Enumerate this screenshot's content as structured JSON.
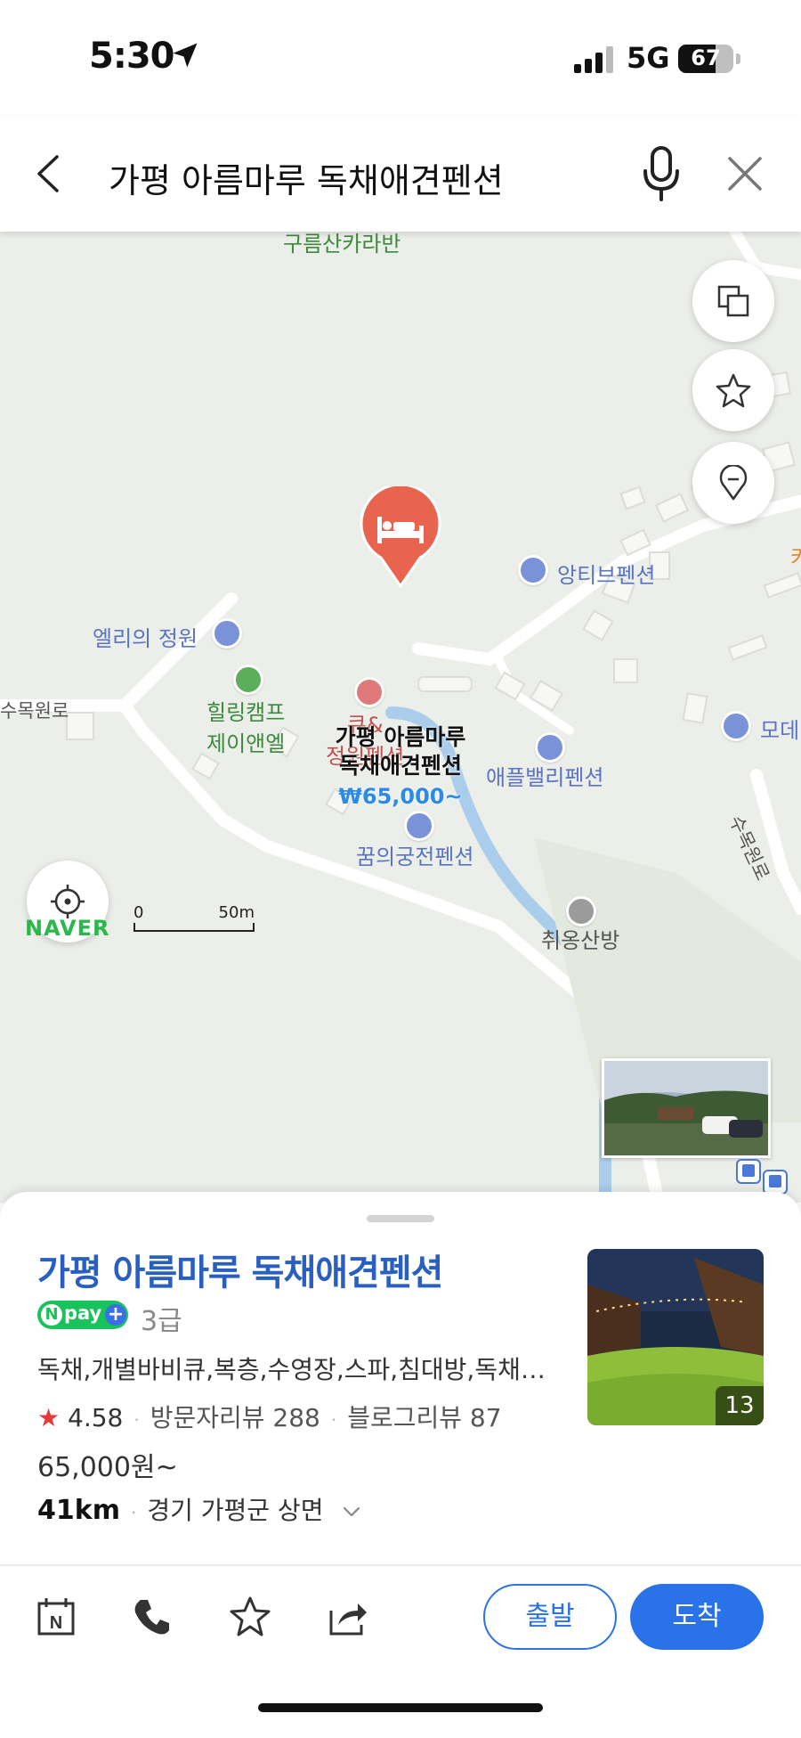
{
  "status_bar": {
    "time": "5:30",
    "network": "5G",
    "battery": "67"
  },
  "search": {
    "query": "가평 아름마루 독채애견펜션"
  },
  "map": {
    "labels": {
      "top_label": "구름산카라반",
      "angtib": "앙티브펜션",
      "ellie": "엘리의 정원",
      "healing_1": "힐링캠프",
      "healing_2": "제이앤엘",
      "q_1": "큐&",
      "q_2": "정원펜션",
      "applevalley": "애플밸리펜션",
      "dream": "꿈의궁전펜션",
      "chuiong": "취옹산방",
      "sumokwonro_left": "수목원로",
      "sumokwonro_right": "수목원로",
      "mode_partial": "모데",
      "ka_partial": "카"
    },
    "pin": {
      "title_line1": "가평 아름마루",
      "title_line2": "독채애견펜션",
      "price": "₩65,000~"
    },
    "brand": "NAVER",
    "scale": {
      "start": "0",
      "end": "50m"
    }
  },
  "place": {
    "title": "가평 아름마루 독채애견펜션",
    "npay": "pay",
    "grade": "3급",
    "amenities": "독채,개별바비큐,복층,수영장,스파,침대방,독채애견펜션",
    "rating": "4.58",
    "visitor_reviews": "방문자리뷰 288",
    "blog_reviews": "블로그리뷰 87",
    "price": "65,000원~",
    "distance": "41km",
    "address": "경기 가평군 상면",
    "photo_count": "13"
  },
  "actions": {
    "depart": "출발",
    "arrive": "도착"
  },
  "colors": {
    "accent": "#2a72e8",
    "title": "#2a5fc2",
    "pin": "#e8644f",
    "npay": "#19c35b"
  }
}
